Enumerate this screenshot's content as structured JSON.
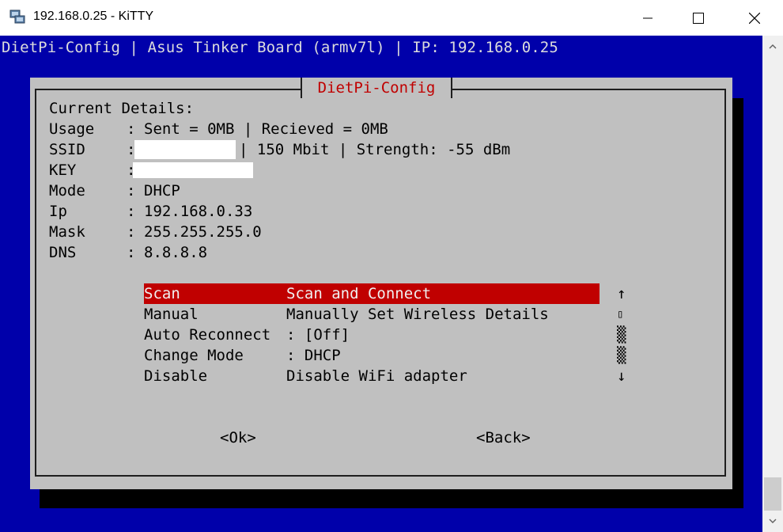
{
  "window": {
    "title": "192.168.0.25 - KiTTY"
  },
  "terminal": {
    "header": "DietPi-Config | Asus Tinker Board (armv7l) | IP: 192.168.0.25"
  },
  "dialog": {
    "title": "DietPi-Config",
    "current_details": "Current Details:",
    "usage": {
      "label": "Usage",
      "sep": ":",
      "value": "Sent = 0MB | Recieved = 0MB"
    },
    "ssid": {
      "label": "SSID",
      "sep": ":",
      "value": "| 150 Mbit | Strength: -55 dBm"
    },
    "key": {
      "label": "KEY",
      "sep": ":"
    },
    "mode": {
      "label": "Mode",
      "sep": ":",
      "value": "DHCP"
    },
    "ip": {
      "label": "Ip",
      "sep": ":",
      "value": "192.168.0.33"
    },
    "mask": {
      "label": "Mask",
      "sep": ":",
      "value": "255.255.255.0"
    },
    "dns": {
      "label": "DNS",
      "sep": ":",
      "value": "8.8.8.8"
    },
    "menu": [
      {
        "tag": "Scan",
        "item": "Scan and Connect",
        "selected": true
      },
      {
        "tag": "Manual",
        "item": "Manually Set Wireless Details",
        "selected": false
      },
      {
        "tag": "Auto Reconnect",
        "item": ": [Off]",
        "selected": false
      },
      {
        "tag": "Change Mode",
        "item": ": DHCP",
        "selected": false
      },
      {
        "tag": "Disable",
        "item": "Disable WiFi adapter",
        "selected": false
      }
    ],
    "scroll_up": "↑",
    "scroll_mid": "▯",
    "scroll_track": "▒",
    "scroll_down": "↓",
    "ok_label": "<Ok>",
    "back_label": "<Back>"
  },
  "colors": {
    "terminal_bg": "#0000aa",
    "dialog_bg": "#c0c0c0",
    "accent": "#c00000"
  }
}
